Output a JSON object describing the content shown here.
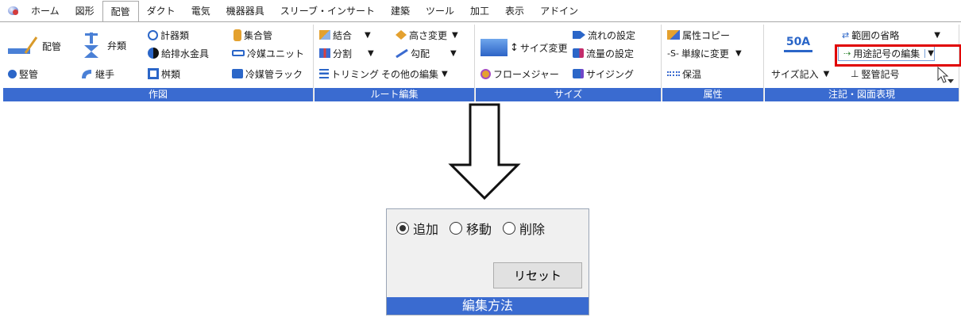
{
  "menu": {
    "tabs": [
      "ホーム",
      "図形",
      "配管",
      "ダクト",
      "電気",
      "機器器具",
      "スリーブ・インサート",
      "建築",
      "ツール",
      "加工",
      "表示",
      "アドイン"
    ],
    "active_tab": "配管"
  },
  "groups": {
    "drawing": {
      "title": "作図",
      "items": {
        "pipe": "配管",
        "valve": "弁類",
        "gauge": "計器類",
        "header": "集合管",
        "plumbing": "給排水金具",
        "refrig_unit": "冷媒ユニット",
        "riser": "竪管",
        "fitting": "継手",
        "basin": "桝類",
        "refrig_rack": "冷媒管ラック"
      }
    },
    "route": {
      "title": "ルート編集",
      "items": {
        "join": "結合",
        "height": "高さ変更",
        "split": "分割",
        "slope": "勾配",
        "trim": "トリミング",
        "other_edit": "その他の編集"
      }
    },
    "size": {
      "title": "サイズ",
      "items": {
        "size_change": "サイズ変更",
        "flow_setting": "流れの設定",
        "flow_rate": "流量の設定",
        "flow_measure": "フローメジャー",
        "sizing": "サイジング"
      }
    },
    "attribute": {
      "title": "属性",
      "items": {
        "attr_copy": "属性コピー",
        "single_line": "単線に変更",
        "insulation": "保温",
        "single_line_prefix": "-S-"
      }
    },
    "annotation": {
      "title": "注記・図面表現",
      "items": {
        "size_label_icon": "50A",
        "range_omit": "範囲の省略",
        "purpose_edit": "用途記号の編集",
        "size_entry": "サイズ記入",
        "riser_symbol": "竪管記号"
      }
    }
  },
  "dialog": {
    "radios": [
      {
        "label": "追加",
        "checked": true
      },
      {
        "label": "移動",
        "checked": false
      },
      {
        "label": "削除",
        "checked": false
      }
    ],
    "reset_label": "リセット",
    "title": "編集方法"
  },
  "colors": {
    "accent": "#3a6bd0",
    "highlight": "#e00000"
  }
}
